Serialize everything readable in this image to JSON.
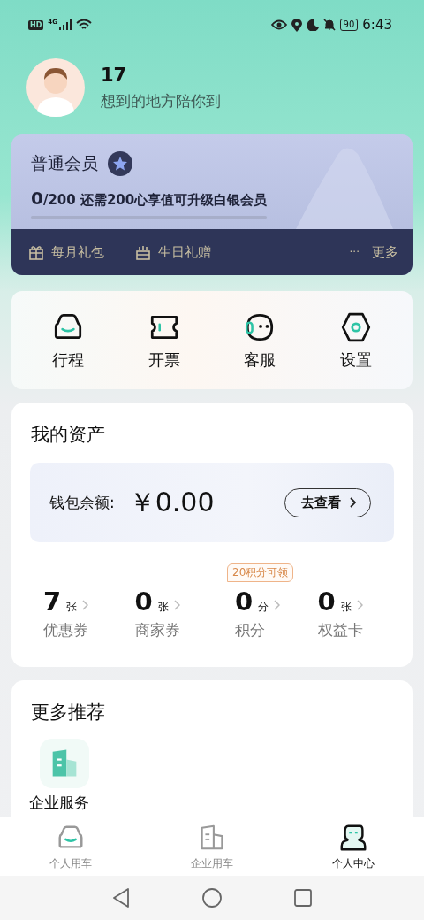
{
  "status_bar": {
    "hd": "HD",
    "network": "4G",
    "battery": "90",
    "time": "6:43"
  },
  "profile": {
    "name": "17",
    "tagline": "想到的地方陪你到"
  },
  "membership": {
    "tier": "普通会员",
    "progress_value": "0",
    "progress_total": "/200",
    "progress_text": "还需200心享值可升级白银会员",
    "level": 0,
    "perks": [
      {
        "label": "每月礼包",
        "kind": "gift"
      },
      {
        "label": "生日礼赠",
        "kind": "cake"
      }
    ],
    "more": {
      "dots": "···",
      "label": "更多"
    }
  },
  "quick_actions": [
    {
      "label": "行程",
      "kind": "car"
    },
    {
      "label": "开票",
      "kind": "ticket"
    },
    {
      "label": "客服",
      "kind": "face"
    },
    {
      "label": "设置",
      "kind": "hexagon"
    }
  ],
  "assets": {
    "title": "我的资产",
    "wallet": {
      "label": "钱包余额:",
      "amount": "￥0.00",
      "button": "去查看"
    },
    "items": [
      {
        "value": "7",
        "unit": "张",
        "label": "优惠券"
      },
      {
        "value": "0",
        "unit": "张",
        "label": "商家券"
      },
      {
        "value": "0",
        "unit": "分",
        "label": "积分",
        "badge": "20积分可领"
      },
      {
        "value": "0",
        "unit": "张",
        "label": "权益卡"
      }
    ]
  },
  "recommend": {
    "title": "更多推荐",
    "items": [
      {
        "label": "企业服务",
        "kind": "building"
      }
    ]
  },
  "tabs": [
    {
      "label": "个人用车",
      "kind": "car",
      "selected": false
    },
    {
      "label": "企业用车",
      "kind": "building",
      "selected": false
    },
    {
      "label": "个人中心",
      "kind": "person",
      "selected": true
    }
  ]
}
